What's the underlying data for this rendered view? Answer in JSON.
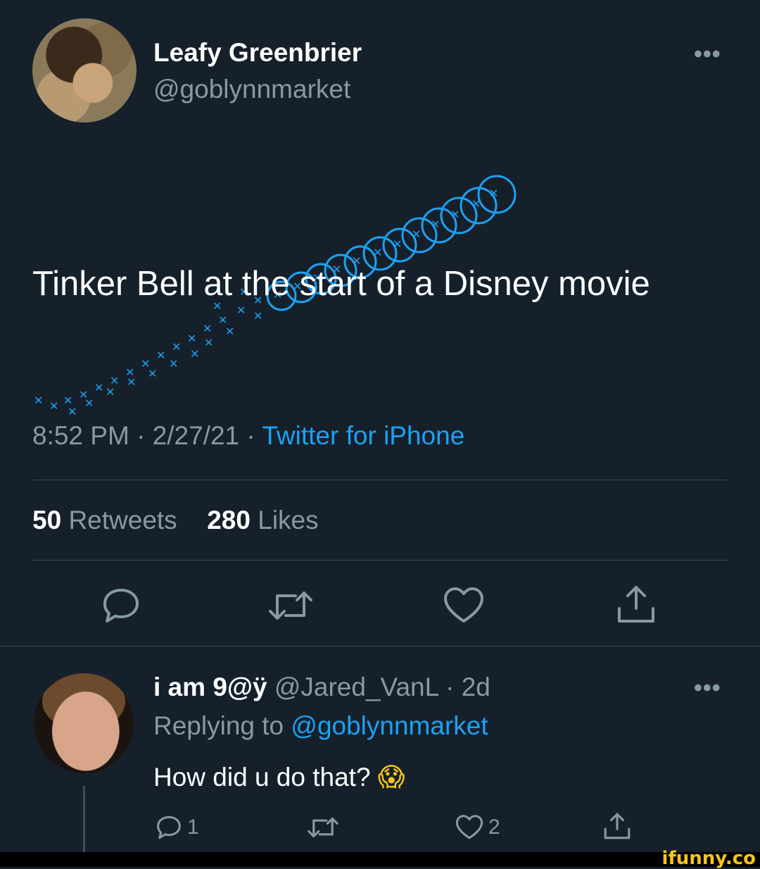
{
  "tweet": {
    "author_name": "Leafy Greenbrier",
    "author_handle": "@goblynnmarket",
    "text": "Tinker Bell at the start of a Disney movie",
    "time": "8:52 PM",
    "sep1": "·",
    "date": "2/27/21",
    "sep2": "·",
    "source": "Twitter for iPhone",
    "retweets_count": "50",
    "retweets_label": "Retweets",
    "likes_count": "280",
    "likes_label": "Likes",
    "more": "•••"
  },
  "reply": {
    "author_name": "i am 9@ÿ",
    "author_handle": "@Jared_VanL",
    "sep": "·",
    "age": "2d",
    "replying_prefix": "Replying to",
    "replying_handle": "@goblynnmarket",
    "text": "How did u do that?",
    "emoji": "😱",
    "reply_count": "1",
    "like_count": "2",
    "more": "•••"
  },
  "icons": {
    "reply": "reply-icon",
    "retweet": "retweet-icon",
    "like": "heart-icon",
    "share": "share-icon",
    "more": "more-icon"
  },
  "colors": {
    "background": "#15202b",
    "accent": "#1da1f2",
    "secondary_text": "#8899a6",
    "divider": "#38444d"
  },
  "watermark": "ifunny.co"
}
